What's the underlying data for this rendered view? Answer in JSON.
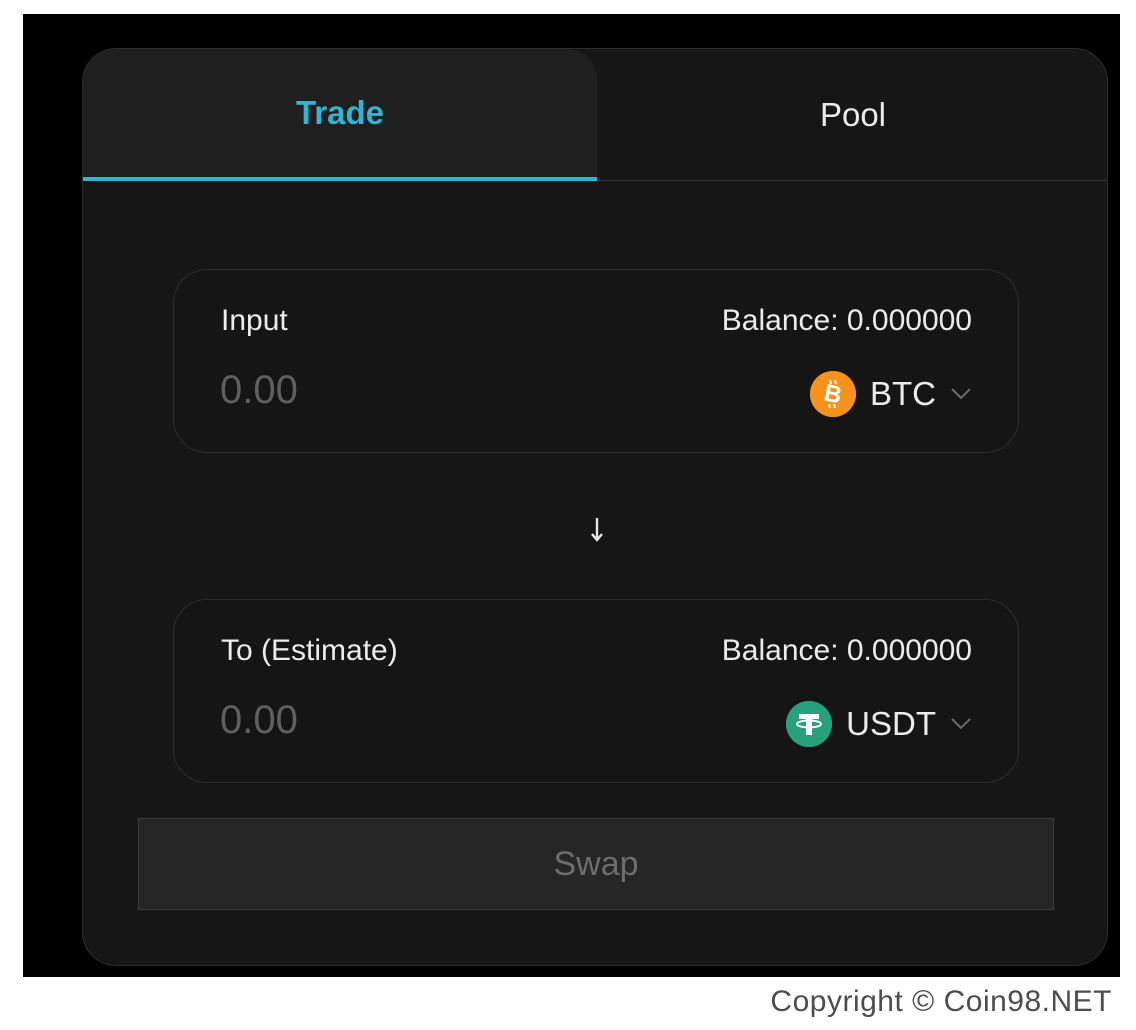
{
  "tabs": [
    {
      "label": "Trade",
      "active": true
    },
    {
      "label": "Pool",
      "active": false
    }
  ],
  "input_box": {
    "label": "Input",
    "balance": "Balance: 0.000000",
    "amount_placeholder": "0.00",
    "token": {
      "symbol": "BTC",
      "icon": "bitcoin-icon",
      "color": "#f7931a"
    }
  },
  "output_box": {
    "label": "To (Estimate)",
    "balance": "Balance: 0.000000",
    "amount_placeholder": "0.00",
    "token": {
      "symbol": "USDT",
      "icon": "tether-icon",
      "color": "#26a17b"
    }
  },
  "direction_icon": "arrow-down-icon",
  "swap_button": {
    "label": "Swap",
    "enabled": false
  },
  "copyright": "Copyright © Coin98.NET",
  "colors": {
    "accent": "#2ab7d8",
    "background": "#161616",
    "frame": "#000000"
  }
}
